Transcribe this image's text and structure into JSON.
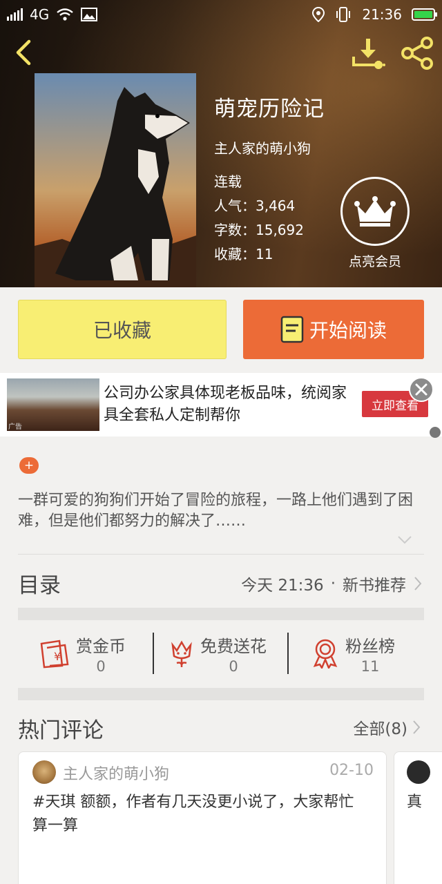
{
  "statusbar": {
    "network": "4G",
    "time": "21:36"
  },
  "book": {
    "title": "萌宠历险记",
    "author": "主人家的萌小狗",
    "status": "连载",
    "popularity": "人气：3,464",
    "word_count": "字数：15,692",
    "favorites": "收藏：11"
  },
  "vip": {
    "label": "点亮会员"
  },
  "actions": {
    "favorited_label": "已收藏",
    "read_label": "开始阅读"
  },
  "ad": {
    "text": "公司办公家具体现老板品味，统阅家具全套私人定制帮你",
    "button": "立即查看",
    "tag": "广告"
  },
  "description": {
    "plus": "+",
    "text": "一群可爱的狗狗们开始了冒险的旅程，一路上他们遇到了困难，但是他们都努力的解决了……"
  },
  "catalog": {
    "title": "目录",
    "update_time": "今天 21:36",
    "separator": "·",
    "recommend": "新书推荐"
  },
  "stats": [
    {
      "label": "赏金币",
      "value": "0",
      "icon": "reward-coin-icon"
    },
    {
      "label": "免费送花",
      "value": "0",
      "icon": "flower-icon"
    },
    {
      "label": "粉丝榜",
      "value": "11",
      "icon": "medal-icon"
    }
  ],
  "comments": {
    "title": "热门评论",
    "all_label": "全部(8)",
    "items": [
      {
        "user": "主人家的萌小狗",
        "date": "02-10",
        "text": "#天琪 额额，作者有几天没更小说了，大家帮忙算一算"
      },
      {
        "text": "真"
      }
    ]
  },
  "colors": {
    "accent": "#ec6b37",
    "favorite_button": "#f8ee73",
    "icon_yellow": "#f3e266"
  }
}
